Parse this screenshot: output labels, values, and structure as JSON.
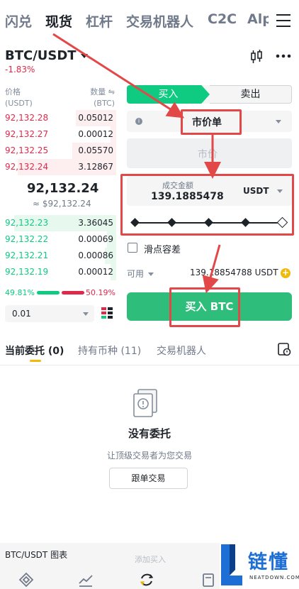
{
  "top_nav": {
    "tabs": [
      {
        "label": "闪兑"
      },
      {
        "label": "现货"
      },
      {
        "label": "杠杆"
      },
      {
        "label": "交易机器人"
      },
      {
        "label": "C2C"
      },
      {
        "label": "Alp"
      }
    ],
    "active_index": 1,
    "menu_icon": "hamburger-menu-icon"
  },
  "ticker": {
    "pair": "BTC/USDT",
    "change": "-1.83%",
    "chart_icon": "candlestick-icon",
    "more_icon": "more-dots-icon"
  },
  "order_book": {
    "price_header": "价格",
    "price_unit": "(USDT)",
    "qty_header": "数量 ⇋",
    "qty_unit": "(BTC)",
    "asks": [
      {
        "price": "92,132.28",
        "qty": "0.05012",
        "depth": 0.35
      },
      {
        "price": "92,132.27",
        "qty": "0.00012",
        "depth": 0.05
      },
      {
        "price": "92,132.25",
        "qty": "0.05570",
        "depth": 0.38
      },
      {
        "price": "92,132.24",
        "qty": "3.12867",
        "depth": 0.85
      }
    ],
    "last_price": "92,132.24",
    "last_fiat": "≈ $92,132.24",
    "bids": [
      {
        "price": "92,132.23",
        "qty": "3.36045",
        "depth": 0.88
      },
      {
        "price": "92,132.22",
        "qty": "0.00069",
        "depth": 0.08
      },
      {
        "price": "92,132.21",
        "qty": "0.00086",
        "depth": 0.1
      },
      {
        "price": "92,132.19",
        "qty": "0.00012",
        "depth": 0.05
      }
    ],
    "buy_ratio": "49.81%",
    "sell_ratio": "50.19%",
    "depth_step": "0.01",
    "layout_icon": "orderbook-layout-icon"
  },
  "order_form": {
    "buy_tab": "买入",
    "sell_tab": "卖出",
    "order_type": "市价单",
    "price_placeholder": "市价",
    "amount_label": "成交金额",
    "amount_value": "139.1885478",
    "amount_currency": "USDT",
    "slider_percent": 100,
    "slippage_label": "滑点容差",
    "available_label": "可用",
    "available_value": "139.18854788 USDT",
    "submit_label": "买入 BTC"
  },
  "orders": {
    "tabs": [
      {
        "label": "当前委托 (0)"
      },
      {
        "label": "持有币种 (11)"
      },
      {
        "label": "交易机器人"
      }
    ],
    "empty_title": "没有委托",
    "empty_subtitle": "让顶级交易者为您交易",
    "copy_trade_button": "跟单交易"
  },
  "bottom": {
    "chart_label": "BTC/USDT 图表",
    "ghost_text": "添加买入",
    "nav_icons": [
      "home-icon",
      "markets-icon",
      "trade-icon",
      "wallet-icon"
    ]
  },
  "watermark": {
    "cn": "链懂",
    "en": "NEATDOWN.COM"
  },
  "colors": {
    "buy": "#0ecb81",
    "sell": "#e0294a",
    "annotation": "#e34848",
    "brand_yellow": "#f0b90b"
  }
}
